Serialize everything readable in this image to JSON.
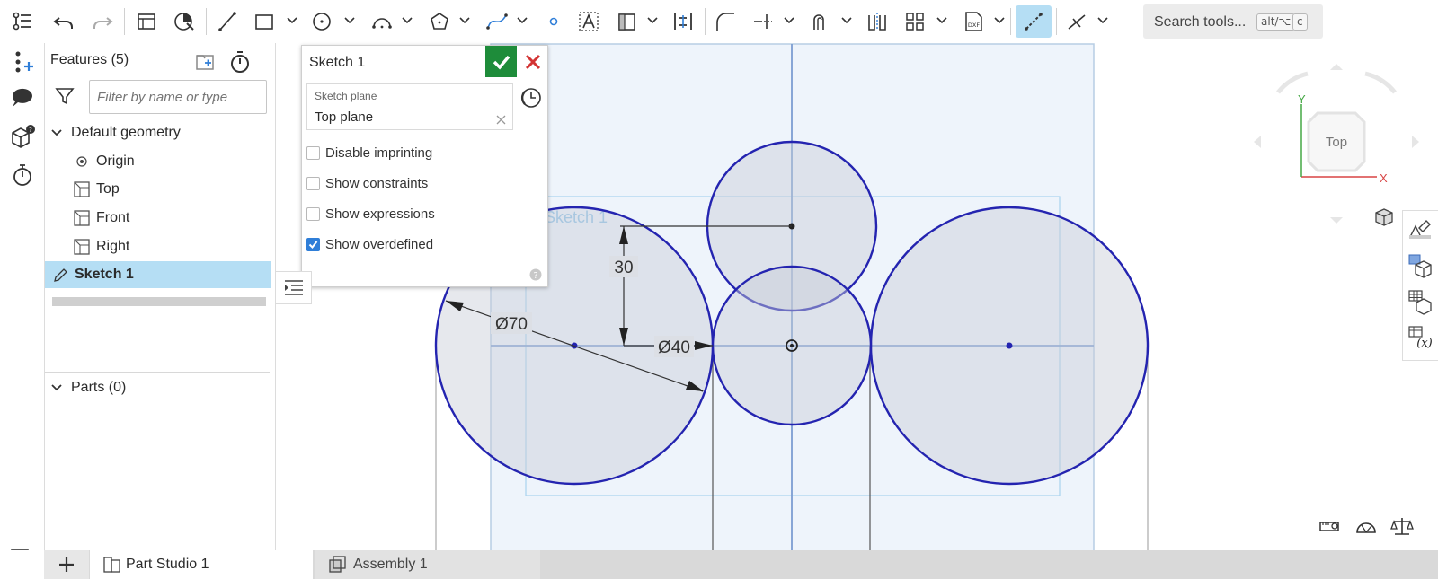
{
  "toolbar": {
    "search_label": "Search tools...",
    "search_shortcut_1": "alt/⌥",
    "search_shortcut_2": "c",
    "icons": [
      "undo-icon",
      "redo-icon",
      "new-sketch-icon",
      "extrude-icon",
      "line-icon",
      "rectangle-icon",
      "circle-icon",
      "arc-icon",
      "polygon-icon",
      "spline-icon",
      "point-icon",
      "text-icon",
      "fillet-icon",
      "trim-icon",
      "offset-icon",
      "dimension-icon",
      "pattern-icon",
      "dxf-icon",
      "construction-icon",
      "snap-icon"
    ]
  },
  "features_panel": {
    "title": "Features (5)",
    "filter_placeholder": "Filter by name or type",
    "default_geometry_label": "Default geometry",
    "items": [
      {
        "label": "Origin"
      },
      {
        "label": "Top"
      },
      {
        "label": "Front"
      },
      {
        "label": "Right"
      },
      {
        "label": "Sketch 1"
      }
    ],
    "parts_label": "Parts (0)"
  },
  "sketch_dialog": {
    "title": "Sketch 1",
    "plane_label": "Sketch plane",
    "plane_value": "Top plane",
    "options": [
      {
        "label": "Disable imprinting",
        "checked": false
      },
      {
        "label": "Show constraints",
        "checked": false
      },
      {
        "label": "Show expressions",
        "checked": false
      },
      {
        "label": "Show overdefined",
        "checked": true
      }
    ]
  },
  "viewport": {
    "sketch_label": "Sketch 1",
    "dim_30": "30",
    "dim_d70": "Ø70",
    "dim_d40": "Ø40",
    "view_cube_label": "Top",
    "axis_x": "X",
    "axis_y": "Y"
  },
  "tabs": [
    {
      "label": "Part Studio 1",
      "active": true
    },
    {
      "label": "Assembly 1",
      "active": false
    }
  ],
  "colors": {
    "accent": "#2f7ed8",
    "selection": "#b5def4",
    "sketch_line": "#2222aa",
    "ok_green": "#1e8c3a",
    "cancel_red": "#d33333"
  }
}
